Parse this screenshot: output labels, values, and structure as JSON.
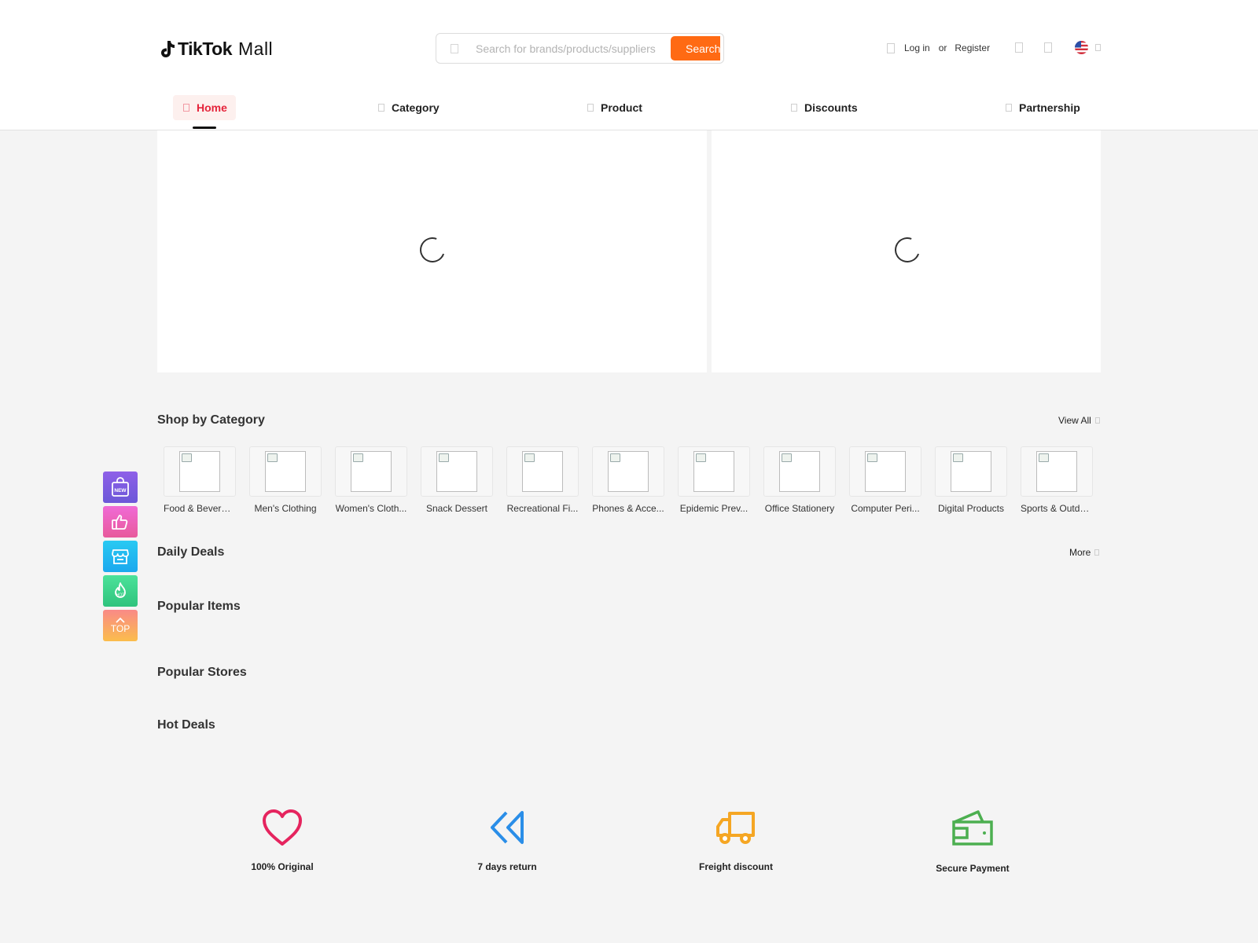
{
  "header": {
    "logo": {
      "brand": "TikTok",
      "suffix": "Mall"
    },
    "search": {
      "placeholder": "Search for brands/products/suppliers",
      "button_label": "Search"
    },
    "user": {
      "login": "Log in",
      "or": "or",
      "register": "Register"
    },
    "nav": [
      {
        "label": "Home",
        "active": true
      },
      {
        "label": "Category"
      },
      {
        "label": "Product"
      },
      {
        "label": "Discounts"
      },
      {
        "label": "Partnership"
      }
    ]
  },
  "sections": {
    "shop_by_category": {
      "title": "Shop by Category",
      "link": "View All"
    },
    "daily_deals": {
      "title": "Daily Deals",
      "link": "More"
    },
    "popular_items": {
      "title": "Popular Items"
    },
    "popular_stores": {
      "title": "Popular Stores"
    },
    "hot_deals": {
      "title": "Hot Deals"
    }
  },
  "categories": [
    "Food & Beverage",
    "Men's Clothing",
    "Women's Cloth...",
    "Snack Dessert",
    "Recreational Fi...",
    "Phones & Acce...",
    "Epidemic Prev...",
    "Office Stationery",
    "Computer Peri...",
    "Digital Products",
    "Sports & Outdo..."
  ],
  "side_float": {
    "new_badge": "NEW",
    "hot_badge": "HOT",
    "top_label": "TOP"
  },
  "features": [
    {
      "label": "100% Original",
      "icon": "heart-icon",
      "color": "#e5245e"
    },
    {
      "label": "7 days return",
      "icon": "double-chevron-left-icon",
      "color": "#2a8ee8"
    },
    {
      "label": "Freight discount",
      "icon": "truck-icon",
      "color": "#f5a623"
    },
    {
      "label": "Secure Payment",
      "icon": "wallet-icon",
      "color": "#4caf50"
    }
  ],
  "colors": {
    "accent": "#ff6a13",
    "active_nav": "#e5243b",
    "background": "#f4f4f4"
  }
}
